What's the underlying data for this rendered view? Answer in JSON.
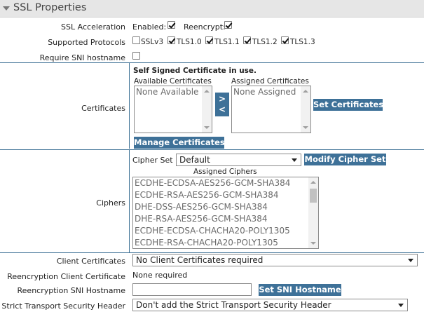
{
  "section": {
    "title": "SSL Properties"
  },
  "ssl_acceleration": {
    "label": "SSL Acceleration",
    "enabled_label": "Enabled:",
    "enabled_checked": true,
    "reencrypt_label": "Reencrypt:",
    "reencrypt_checked": true
  },
  "supported_protocols": {
    "label": "Supported Protocols",
    "items": [
      {
        "label": "SSLv3",
        "checked": false
      },
      {
        "label": "TLS1.0",
        "checked": true
      },
      {
        "label": "TLS1.1",
        "checked": true
      },
      {
        "label": "TLS1.2",
        "checked": true
      },
      {
        "label": "TLS1.3",
        "checked": true
      }
    ]
  },
  "require_sni": {
    "label": "Require SNI hostname",
    "checked": false
  },
  "certificates": {
    "label": "Certificates",
    "status_text": "Self Signed Certificate in use.",
    "available_label": "Available Certificates",
    "available_items": [
      "None Available"
    ],
    "assigned_label": "Assigned Certificates",
    "assigned_items": [
      "None Assigned"
    ],
    "move_right_label": ">",
    "move_left_label": "<",
    "set_button": "Set Certificates",
    "manage_button": "Manage Certificates"
  },
  "ciphers": {
    "label": "Ciphers",
    "cipher_set_label": "Cipher Set",
    "cipher_set_value": "Default",
    "modify_button": "Modify Cipher Set",
    "assigned_label": "Assigned Ciphers",
    "items": [
      "ECDHE-ECDSA-AES256-GCM-SHA384",
      "ECDHE-RSA-AES256-GCM-SHA384",
      "DHE-DSS-AES256-GCM-SHA384",
      "DHE-RSA-AES256-GCM-SHA384",
      "ECDHE-ECDSA-CHACHA20-POLY1305",
      "ECDHE-RSA-CHACHA20-POLY1305"
    ]
  },
  "client_certificates": {
    "label": "Client Certificates",
    "value": "No Client Certificates required"
  },
  "reencryption_client_certificate": {
    "label": "Reencryption Client Certificate",
    "value": "None required"
  },
  "reencryption_sni": {
    "label": "Reencryption SNI Hostname",
    "value": "",
    "button": "Set SNI Hostname"
  },
  "strict_transport": {
    "label": "Strict Transport Security Header",
    "value": "Don't add the Strict Transport Security Header"
  }
}
